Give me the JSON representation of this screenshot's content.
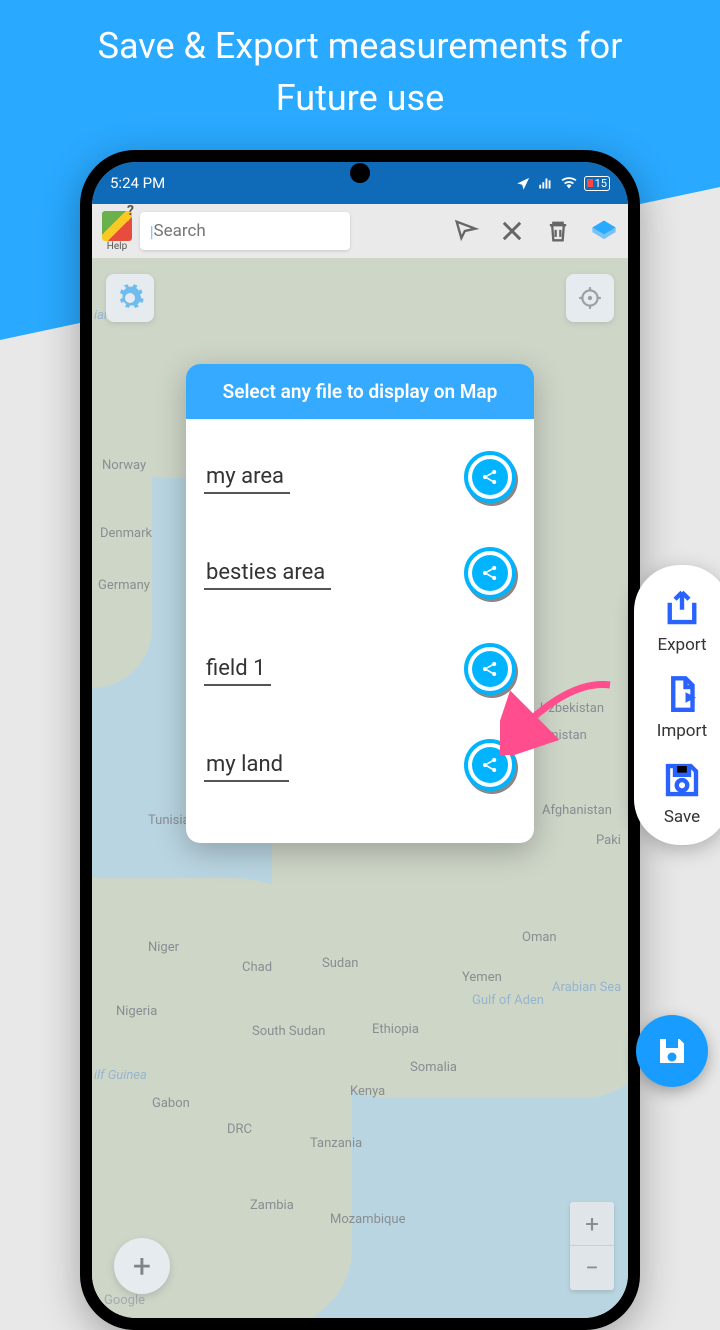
{
  "promo": {
    "title_line1": "Save & Export measurements for",
    "title_line2": "Future use"
  },
  "status": {
    "time": "5:24 PM",
    "battery": "15"
  },
  "toolbar": {
    "help_label": "Help",
    "search_placeholder": "Search"
  },
  "dialog": {
    "title": "Select any file to display on Map",
    "files": [
      {
        "name": "my area"
      },
      {
        "name": "besties area"
      },
      {
        "name": "field 1"
      },
      {
        "name": "my land"
      }
    ]
  },
  "side_panel": {
    "export": "Export",
    "import": "Import",
    "save": "Save"
  },
  "map_labels": {
    "norway": "Norway",
    "denmark": "Denmark",
    "germany": "Germany",
    "uzbekistan": "Uzbekistan",
    "rkmenistan": "rkmenistan",
    "tunisia": "Tunisia",
    "afghanistan": "Afghanistan",
    "paki": "Paki",
    "niger": "Niger",
    "chad": "Chad",
    "sudan": "Sudan",
    "oman": "Oman",
    "yemen": "Yemen",
    "gulf_aden": "Gulf of Aden",
    "arabian_sea": "Arabian Sea",
    "nigeria": "Nigeria",
    "ethiopia": "Ethiopia",
    "south_sudan": "South Sudan",
    "somalia": "Somalia",
    "guinea": "ilf Guinea",
    "gabon": "Gabon",
    "kenya": "Kenya",
    "drc": "DRC",
    "tanzania": "Tanzania",
    "zambia": "Zambia",
    "mozambique": "Mozambique",
    "ian_sea": "ian Sea",
    "google": "Google"
  },
  "zoom": {
    "in": "+",
    "out": "−"
  },
  "colors": {
    "primary": "#29a9ff",
    "accent": "#2962ff"
  }
}
